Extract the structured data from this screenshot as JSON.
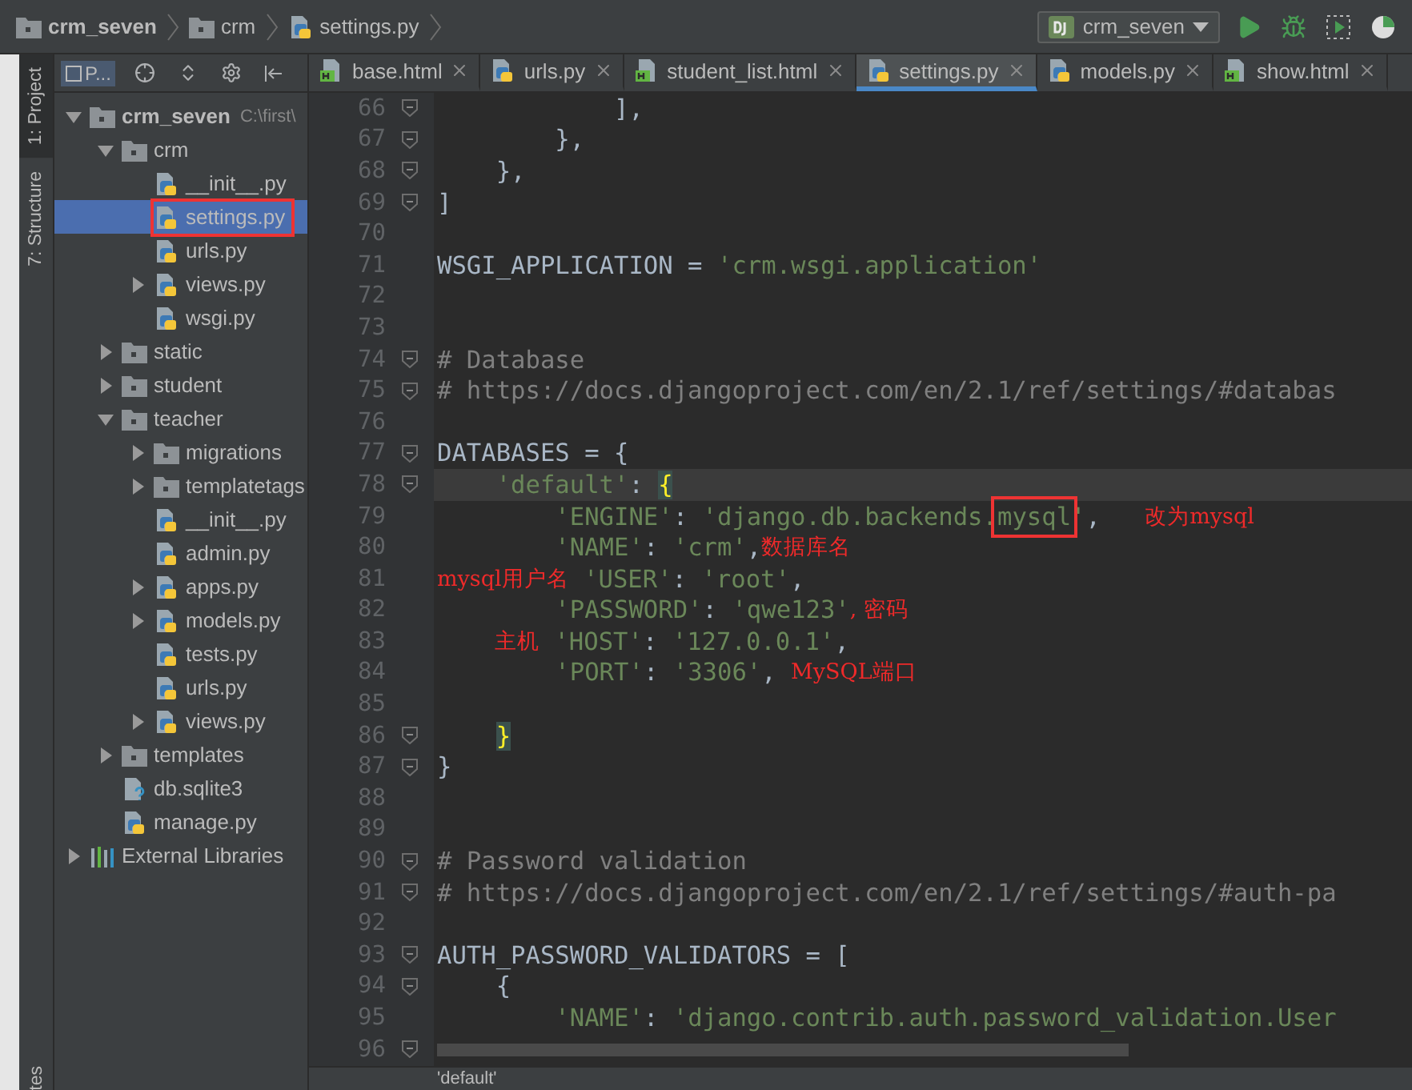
{
  "navbar": {
    "crumbs": [
      {
        "kind": "folder-bold",
        "label": "crm_seven"
      },
      {
        "kind": "folder",
        "label": "crm"
      },
      {
        "kind": "py",
        "label": "settings.py"
      }
    ],
    "run_config": "crm_seven"
  },
  "side_strip": [
    {
      "label": "1: Project",
      "selected": true
    },
    {
      "label": "7: Structure",
      "selected": false
    }
  ],
  "side_strip_bottom": "tes",
  "project_panel": {
    "view": "P...",
    "tree": [
      {
        "kind": "root",
        "label": "crm_seven",
        "path": "C:\\first\\",
        "expanded": true,
        "selected": false,
        "boxed": false,
        "children": [
          {
            "kind": "folder",
            "label": "crm",
            "expanded": true,
            "selected": false,
            "boxed": false,
            "children": [
              {
                "kind": "py",
                "label": "__init__.py",
                "selected": false,
                "boxed": false
              },
              {
                "kind": "py",
                "label": "settings.py",
                "selected": true,
                "boxed": true
              },
              {
                "kind": "py",
                "label": "urls.py",
                "selected": false,
                "boxed": false
              },
              {
                "kind": "py",
                "label": "views.py",
                "expanded": false,
                "selected": false,
                "boxed": false
              },
              {
                "kind": "py",
                "label": "wsgi.py",
                "selected": false,
                "boxed": false
              }
            ]
          },
          {
            "kind": "folder",
            "label": "static",
            "expanded": false,
            "selected": false,
            "boxed": false
          },
          {
            "kind": "folder",
            "label": "student",
            "expanded": false,
            "selected": false,
            "boxed": false
          },
          {
            "kind": "folder",
            "label": "teacher",
            "expanded": true,
            "selected": false,
            "boxed": false,
            "children": [
              {
                "kind": "folder",
                "label": "migrations",
                "expanded": false,
                "selected": false,
                "boxed": false
              },
              {
                "kind": "folder",
                "label": "templatetags",
                "expanded": false,
                "selected": false,
                "boxed": false
              },
              {
                "kind": "py",
                "label": "__init__.py",
                "selected": false,
                "boxed": false
              },
              {
                "kind": "py",
                "label": "admin.py",
                "selected": false,
                "boxed": false
              },
              {
                "kind": "py",
                "label": "apps.py",
                "expanded": false,
                "selected": false,
                "boxed": false
              },
              {
                "kind": "py",
                "label": "models.py",
                "expanded": false,
                "selected": false,
                "boxed": false
              },
              {
                "kind": "py",
                "label": "tests.py",
                "selected": false,
                "boxed": false
              },
              {
                "kind": "py",
                "label": "urls.py",
                "selected": false,
                "boxed": false
              },
              {
                "kind": "py",
                "label": "views.py",
                "expanded": false,
                "selected": false,
                "boxed": false
              }
            ]
          },
          {
            "kind": "folder",
            "label": "templates",
            "expanded": false,
            "selected": false,
            "boxed": false
          },
          {
            "kind": "db",
            "label": "db.sqlite3",
            "selected": false,
            "boxed": false
          },
          {
            "kind": "py",
            "label": "manage.py",
            "selected": false,
            "boxed": false
          }
        ]
      },
      {
        "kind": "libs",
        "label": "External Libraries",
        "expanded": false,
        "selected": false,
        "boxed": false
      }
    ]
  },
  "tabs": [
    {
      "kind": "html",
      "label": "base.html",
      "selected": false
    },
    {
      "kind": "py",
      "label": "urls.py",
      "selected": false
    },
    {
      "kind": "html",
      "label": "student_list.html",
      "selected": false
    },
    {
      "kind": "py",
      "label": "settings.py",
      "selected": true
    },
    {
      "kind": "py",
      "label": "models.py",
      "selected": false
    },
    {
      "kind": "html",
      "label": "show.html",
      "selected": false
    }
  ],
  "editor": {
    "lines": [
      {
        "number": "66",
        "fold": true,
        "current": false,
        "segments": [
          {
            "kind": "plain",
            "text": "            ],"
          }
        ]
      },
      {
        "number": "67",
        "fold": true,
        "current": false,
        "segments": [
          {
            "kind": "plain",
            "text": "        },"
          }
        ]
      },
      {
        "number": "68",
        "fold": true,
        "current": false,
        "segments": [
          {
            "kind": "plain",
            "text": "    },"
          }
        ]
      },
      {
        "number": "69",
        "fold": true,
        "current": false,
        "segments": [
          {
            "kind": "plain",
            "text": "]"
          }
        ]
      },
      {
        "number": "70",
        "fold": false,
        "current": false
      },
      {
        "number": "71",
        "fold": false,
        "current": false,
        "segments": [
          {
            "kind": "plain",
            "text": "WSGI_APPLICATION = "
          },
          {
            "kind": "string",
            "text": "'crm.wsgi.application'"
          }
        ]
      },
      {
        "number": "72",
        "fold": false,
        "current": false
      },
      {
        "number": "73",
        "fold": false,
        "current": false
      },
      {
        "number": "74",
        "fold": true,
        "current": false,
        "segments": [
          {
            "kind": "comment",
            "text": "# Database"
          }
        ]
      },
      {
        "number": "75",
        "fold": true,
        "current": false,
        "segments": [
          {
            "kind": "comment",
            "text": "# https://docs.djangoproject.com/en/2.1/ref/settings/#databas"
          }
        ]
      },
      {
        "number": "76",
        "fold": false,
        "current": false
      },
      {
        "number": "77",
        "fold": true,
        "current": false,
        "segments": [
          {
            "kind": "plain",
            "text": "DATABASES = {"
          }
        ]
      },
      {
        "number": "78",
        "fold": true,
        "current": true,
        "segments": [
          {
            "kind": "string",
            "text": "    'default'"
          },
          {
            "kind": "plain",
            "text": ": "
          },
          {
            "kind": "brace",
            "text": "{"
          }
        ]
      },
      {
        "number": "79",
        "fold": false,
        "current": false,
        "segments": [
          {
            "kind": "string",
            "text": "        'ENGINE'"
          },
          {
            "kind": "plain",
            "text": ": "
          },
          {
            "kind": "string",
            "text": "'django.db.backends."
          },
          {
            "kind": "boxed",
            "text": "mysql"
          },
          {
            "kind": "string",
            "text": "'"
          },
          {
            "kind": "plain",
            "text": ",   "
          },
          {
            "kind": "note",
            "text": "改为mysql"
          }
        ]
      },
      {
        "number": "80",
        "fold": false,
        "current": false,
        "segments": [
          {
            "kind": "string",
            "text": "        'NAME'"
          },
          {
            "kind": "plain",
            "text": ": "
          },
          {
            "kind": "string",
            "text": "'crm'"
          },
          {
            "kind": "plain",
            "text": ","
          },
          {
            "kind": "note",
            "text": "数据库名"
          }
        ]
      },
      {
        "number": "81",
        "fold": false,
        "current": false,
        "segments": [
          {
            "kind": "note",
            "text": "mysql用户名"
          },
          {
            "kind": "string",
            "text": " 'USER'"
          },
          {
            "kind": "plain",
            "text": ": "
          },
          {
            "kind": "string",
            "text": "'root'"
          },
          {
            "kind": "plain",
            "text": ","
          }
        ]
      },
      {
        "number": "82",
        "fold": false,
        "current": false,
        "segments": [
          {
            "kind": "string",
            "text": "        'PASSWORD'"
          },
          {
            "kind": "plain",
            "text": ": "
          },
          {
            "kind": "string",
            "text": "'qwe123'"
          },
          {
            "kind": "note",
            "text": ", 密码"
          }
        ]
      },
      {
        "number": "83",
        "fold": false,
        "current": false,
        "segments": [
          {
            "kind": "note-indented",
            "text": "主机"
          },
          {
            "kind": "string",
            "text": " 'HOST'"
          },
          {
            "kind": "plain",
            "text": ": "
          },
          {
            "kind": "string",
            "text": "'127.0.0.1'"
          },
          {
            "kind": "plain",
            "text": ","
          }
        ]
      },
      {
        "number": "84",
        "fold": false,
        "current": false,
        "segments": [
          {
            "kind": "string",
            "text": "        'PORT'"
          },
          {
            "kind": "plain",
            "text": ": "
          },
          {
            "kind": "string",
            "text": "'3306'"
          },
          {
            "kind": "plain",
            "text": ", "
          },
          {
            "kind": "note",
            "text": "MySQL端口"
          }
        ]
      },
      {
        "number": "85",
        "fold": false,
        "current": false
      },
      {
        "number": "86",
        "fold": true,
        "current": false,
        "segments": [
          {
            "kind": "brace-indented",
            "text": "}"
          }
        ]
      },
      {
        "number": "87",
        "fold": true,
        "current": false,
        "segments": [
          {
            "kind": "plain",
            "text": "}"
          }
        ]
      },
      {
        "number": "88",
        "fold": false,
        "current": false
      },
      {
        "number": "89",
        "fold": false,
        "current": false
      },
      {
        "number": "90",
        "fold": true,
        "current": false,
        "segments": [
          {
            "kind": "comment",
            "text": "# Password validation"
          }
        ]
      },
      {
        "number": "91",
        "fold": true,
        "current": false,
        "segments": [
          {
            "kind": "comment",
            "text": "# https://docs.djangoproject.com/en/2.1/ref/settings/#auth-pa"
          }
        ]
      },
      {
        "number": "92",
        "fold": false,
        "current": false
      },
      {
        "number": "93",
        "fold": true,
        "current": false,
        "segments": [
          {
            "kind": "plain",
            "text": "AUTH_PASSWORD_VALIDATORS = ["
          }
        ]
      },
      {
        "number": "94",
        "fold": true,
        "current": false,
        "segments": [
          {
            "kind": "plain",
            "text": "    {"
          }
        ]
      },
      {
        "number": "95",
        "fold": false,
        "current": false,
        "segments": [
          {
            "kind": "string",
            "text": "        'NAME'"
          },
          {
            "kind": "plain",
            "text": ": "
          },
          {
            "kind": "string",
            "text": "'django.contrib.auth.password_validation.User"
          }
        ]
      },
      {
        "number": "96",
        "fold": true,
        "current": false
      }
    ]
  },
  "status_bar": {
    "breadcrumb": "'default'"
  }
}
